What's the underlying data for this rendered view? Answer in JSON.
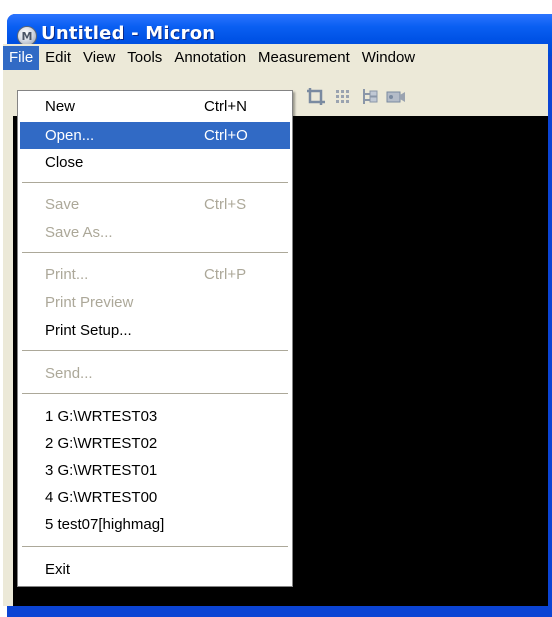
{
  "window": {
    "title": "Untitled - Micron",
    "icon_letter": "M"
  },
  "menubar": {
    "items": [
      "File",
      "Edit",
      "View",
      "Tools",
      "Annotation",
      "Measurement",
      "Window"
    ],
    "active": "File"
  },
  "toolbar": {
    "icons": [
      "crop-icon",
      "grid-icon",
      "tree-icon",
      "camera-icon"
    ]
  },
  "file_menu": {
    "new": {
      "label": "New",
      "shortcut": "Ctrl+N"
    },
    "open": {
      "label": "Open...",
      "shortcut": "Ctrl+O"
    },
    "close": {
      "label": "Close"
    },
    "save": {
      "label": "Save",
      "shortcut": "Ctrl+S"
    },
    "save_as": {
      "label": "Save As..."
    },
    "print": {
      "label": "Print...",
      "shortcut": "Ctrl+P"
    },
    "print_preview": {
      "label": "Print Preview"
    },
    "print_setup": {
      "label": "Print Setup..."
    },
    "send": {
      "label": "Send..."
    },
    "recent": [
      "1 G:\\WRTEST03",
      "2 G:\\WRTEST02",
      "3 G:\\WRTEST01",
      "4 G:\\WRTEST00",
      "5 test07[highmag]"
    ],
    "exit": {
      "label": "Exit"
    }
  },
  "colors": {
    "titlebar": "#0a5ff2",
    "highlight": "#316ac5",
    "menubar_bg": "#ece9d8",
    "disabled_text": "#aca899",
    "canvas": "#000000"
  }
}
